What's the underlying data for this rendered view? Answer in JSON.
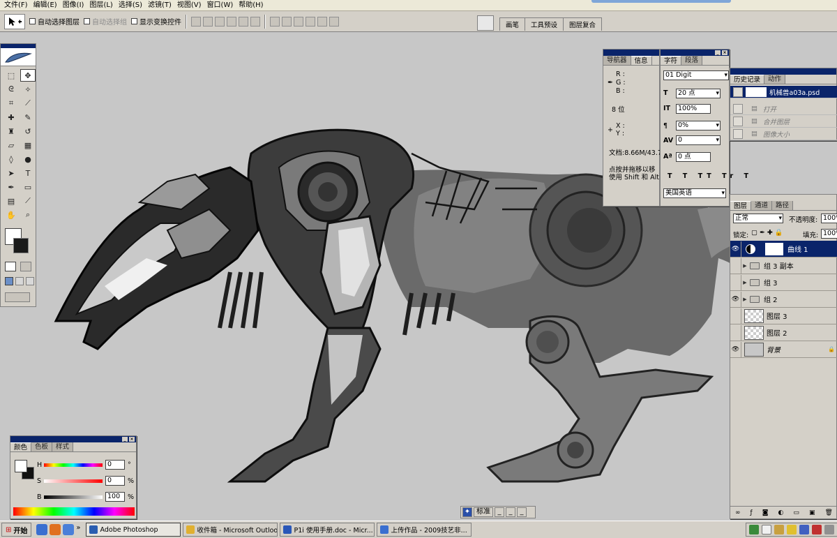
{
  "menubar": [
    "文件(F)",
    "编辑(E)",
    "图像(I)",
    "图层(L)",
    "选择(S)",
    "滤镜(T)",
    "视图(V)",
    "窗口(W)",
    "帮助(H)"
  ],
  "options": {
    "auto_select_layer": "自动选择图层",
    "auto_select_group": "自动选择组",
    "show_transform": "显示变换控件"
  },
  "palette_well": {
    "tabs": [
      "画笔",
      "工具预设",
      "图层复合"
    ]
  },
  "navigator": {
    "tabs": [
      "导航器",
      "信息"
    ],
    "r": "R :",
    "g": "G :",
    "b": "B :",
    "bit": "8 位",
    "x": "X :",
    "y": "Y :",
    "doc": "文档:8.66M/43.7",
    "hint1": "点按并拖移以移",
    "hint2": "使用 Shift 和 Alt"
  },
  "character": {
    "tabs": [
      "字符",
      "段落"
    ],
    "font": "01 Digit",
    "size": "20 点",
    "vscale": "100%",
    "baseline": "0%",
    "tracking": "0",
    "shift": "0 点",
    "lang": "美国英语",
    "tt_buttons": [
      "T",
      "T",
      "TT",
      "Tr",
      "T"
    ]
  },
  "history": {
    "tabs": [
      "历史记录",
      "动作"
    ],
    "snapshot": "机械兽a03a.psd",
    "items": [
      "打开",
      "合并图层",
      "图像大小"
    ]
  },
  "layers": {
    "tabs": [
      "图层",
      "通道",
      "路径"
    ],
    "blend": "正常",
    "opacity_label": "不透明度:",
    "opacity": "100%",
    "lock_label": "锁定:",
    "fill_label": "填充:",
    "fill": "100%",
    "rows": [
      {
        "name": "曲线 1",
        "type": "adjust",
        "eye": true,
        "selected": true
      },
      {
        "name": "组 3 副本",
        "type": "group",
        "eye": false,
        "selected": false
      },
      {
        "name": "组 3",
        "type": "group",
        "eye": false,
        "selected": false
      },
      {
        "name": "组 2",
        "type": "group",
        "eye": true,
        "selected": false
      },
      {
        "name": "图层 3",
        "type": "layer",
        "eye": false,
        "selected": false
      },
      {
        "name": "图层 2",
        "type": "layer",
        "eye": false,
        "selected": false
      },
      {
        "name": "背景",
        "type": "bg",
        "eye": true,
        "selected": false
      }
    ]
  },
  "color": {
    "tabs": [
      "颜色",
      "色板",
      "样式"
    ],
    "h_label": "H",
    "h_val": "0",
    "h_unit": "°",
    "s_label": "S",
    "s_val": "0",
    "s_unit": "%",
    "b_label": "B",
    "b_val": "100",
    "b_unit": "%"
  },
  "ime": {
    "mode": "标准"
  },
  "taskbar": {
    "start": "开始",
    "items": [
      "Adobe Photoshop",
      "收件箱 - Microsoft Outlook",
      "P1i 使用手册.doc - Micr...",
      "上传作品 - 2009技艺非..."
    ],
    "arrow": "»"
  }
}
